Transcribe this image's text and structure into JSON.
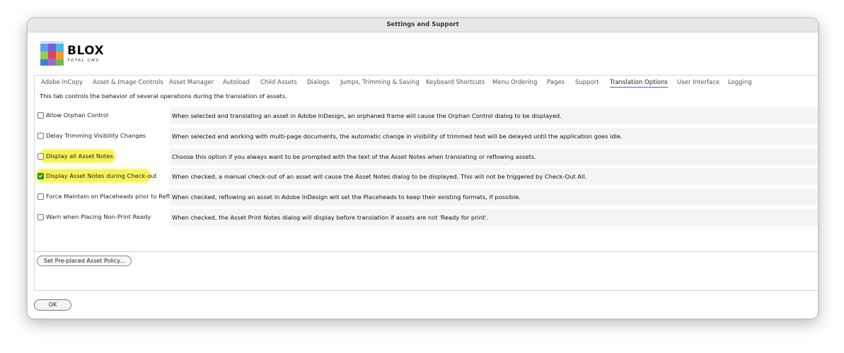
{
  "window": {
    "title": "Settings and Support"
  },
  "logo": {
    "brand": "BLOX",
    "subtitle": "TOTAL CMS"
  },
  "tabs": [
    {
      "label": "Adobe InCopy"
    },
    {
      "label": "Asset & Image Controls"
    },
    {
      "label": "Asset Manager"
    },
    {
      "label": "Autoload"
    },
    {
      "label": "Child Assets"
    },
    {
      "label": "Dialogs"
    },
    {
      "label": "Jumps, Trimming & Saving"
    },
    {
      "label": "Keyboard Shortcuts"
    },
    {
      "label": "Menu Ordering"
    },
    {
      "label": "Pages"
    },
    {
      "label": "Support"
    },
    {
      "label": "Translation Options",
      "active": true
    },
    {
      "label": "User Interface"
    },
    {
      "label": "Logging"
    }
  ],
  "intro": "This tab controls the behavior of several operations during the translation of assets.",
  "options": [
    {
      "label": "Allow Orphan Control",
      "checked": false,
      "highlighted": false,
      "description": "When selected and translating an asset in Adobe InDesign, an orphaned frame will cause the Orphan Control dialog to be displayed."
    },
    {
      "label": "Delay Trimming Visibility Changes",
      "checked": false,
      "highlighted": false,
      "description": "When selected and working with multi-page documents, the automatic change in visibility of trimmed text will be delayed until the application goes idle."
    },
    {
      "label": "Display all Asset Notes",
      "checked": false,
      "highlighted": true,
      "description": "Choose this option if you always want to be prompted with the text of the Asset Notes when translating or reflowing assets."
    },
    {
      "label": "Display Asset Notes during Check-out",
      "checked": true,
      "highlighted": true,
      "description": "When checked, a manual check-out of an asset will cause the Asset Notes dialog to be displayed. This will not be triggered by Check-Out All."
    },
    {
      "label": "Force Maintain on Placeheads prior to Reflow",
      "checked": false,
      "highlighted": false,
      "description": "When checked, reflowing an asset in Adobe InDesign will set the Placeheads to keep their existing formats, if possible."
    },
    {
      "label": "Warn when Placing Non-Print Ready",
      "checked": false,
      "highlighted": false,
      "description": "When checked, the Asset Print Notes dialog will display before translation if assets are not 'Ready for print'."
    }
  ],
  "buttons": {
    "policy": "Set Pre-placed Asset Policy...",
    "ok": "OK"
  },
  "colors": {
    "highlight": "#f7f35c",
    "check_on": "#29a02f",
    "tab_underline": "#2d6bd8"
  }
}
